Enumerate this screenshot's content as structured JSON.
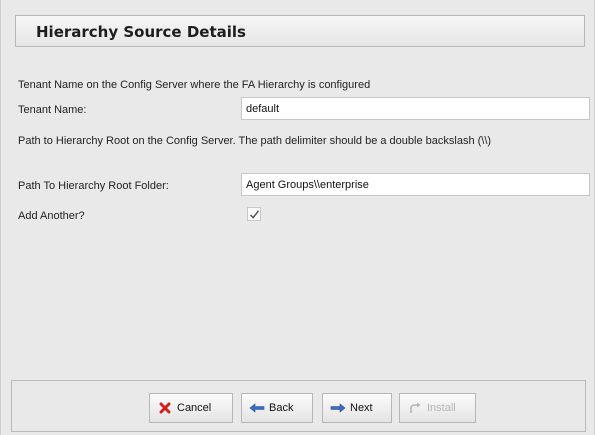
{
  "header": {
    "title": "Hierarchy Source Details"
  },
  "form": {
    "tenant_description": "Tenant Name on the Config Server where the FA Hierarchy is configured",
    "tenant_label": "Tenant Name:",
    "tenant_value": "default",
    "path_description": "Path to Hierarchy Root on the Config Server. The path delimiter should be a double backslash (\\\\)",
    "path_label": "Path To Hierarchy Root Folder:",
    "path_value": "Agent Groups\\\\enterprise",
    "add_another_label": "Add Another?",
    "add_another_checked": true
  },
  "buttons": {
    "cancel": "Cancel",
    "back": "Back",
    "next": "Next",
    "install": "Install"
  },
  "icons": {
    "cancel": "red-x-icon",
    "back": "arrow-left-icon",
    "next": "arrow-right-icon",
    "install": "install-arrow-icon"
  },
  "colors": {
    "cancel_red": "#d2211c",
    "arrow_blue": "#3b6fc4"
  }
}
